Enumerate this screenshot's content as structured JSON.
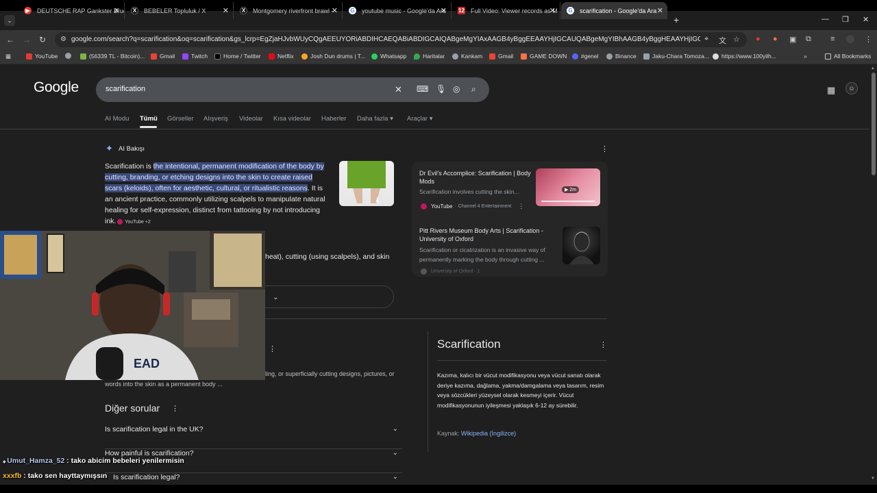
{
  "browser": {
    "tabs": [
      {
        "title": "DEUTSCHE RAP Gankster Bruder",
        "icon_color": "#e53935",
        "icon": "youtube-icon"
      },
      {
        "title": "BEBELER Topluluk / X",
        "icon_color": "#000000",
        "icon": "x-icon"
      },
      {
        "title": "Montgomery riverfront brawl -",
        "icon_color": "#000000",
        "icon": "x-icon"
      },
      {
        "title": "youtube music - Google'da Ara",
        "icon_color": "#4285f4",
        "icon": "google-icon"
      },
      {
        "title": "Full Video: Viewer records as M",
        "icon_color": "#c62828",
        "icon": "news-icon"
      },
      {
        "title": "scarification - Google'da Ara",
        "icon_color": "#4285f4",
        "icon": "google-icon"
      }
    ],
    "url": "google.com/search?q=scarification&oq=scarification&gs_lcrp=EgZjaHJvbWUyCQgAEEUYORiABDIHCAEQABiABDIGCAIQABgeMgYIAxAAGB4yBggEEAAYHjIGCAUQABgeMgYIBhAAGB4yBggHEAAYHjIGCAgQABgeMgYICRAA...",
    "bookmarks": [
      {
        "label": "YouTube",
        "color": "#e53935"
      },
      {
        "label": "",
        "color": "#9aa0a6"
      },
      {
        "label": "(56339 TL - Bitcoin)...",
        "color": "#7cb342"
      },
      {
        "label": "Gmail",
        "color": "#ea4335"
      },
      {
        "label": "Twitch",
        "color": "#9146ff"
      },
      {
        "label": "Home / Twitter",
        "color": "#000000"
      },
      {
        "label": "Netflix",
        "color": "#e50914"
      },
      {
        "label": "Josh Dun drums | T...",
        "color": "#f9a825"
      },
      {
        "label": "Whatsapp",
        "color": "#25d366"
      },
      {
        "label": "Haritalar",
        "color": "#34a853"
      },
      {
        "label": "Kankam",
        "color": "#9aa0a6"
      },
      {
        "label": "Gmail",
        "color": "#ea4335"
      },
      {
        "label": "GAME DOWN",
        "color": "#ff7043"
      },
      {
        "label": "#genel",
        "color": "#5865f2"
      },
      {
        "label": "Binance",
        "color": "#9aa0a6"
      },
      {
        "label": "Jaku-Chara Tomoza...",
        "color": "#9aa0a6"
      },
      {
        "label": "https://www.100yilh...",
        "color": "#dddddd"
      }
    ],
    "all_bookmarks": "All Bookmarks"
  },
  "google": {
    "logo": "Google",
    "query": "scarification",
    "nav": [
      "AI Modu",
      "Tümü",
      "Görseller",
      "Alışveriş",
      "Videolar",
      "Kısa videolar",
      "Haberler",
      "Daha fazla",
      "Araçlar"
    ]
  },
  "ai_overview": {
    "title": "AI Bakışı",
    "lead": "Scarification is ",
    "highlight": "the intentional, permanent modification of the body by cutting, branding, or etching designs into the skin to create raised scars (keloids), often for aesthetic, cultural, or ritualistic reasons",
    "rest": ". It is an ancient practice, commonly utilizing scalpels to manipulate natural healing for self-expression, distinct from tattooing by not introducing ink.",
    "chip": "YouTube +2",
    "partial_line": "heat), cutting (using scalpels), and skin",
    "show_more": "r",
    "cards": [
      {
        "title": "Dr Evil's Accomplice: Scarification | Body Mods",
        "snippet": "Scarification involves cutting the skin...",
        "source": "YouTube",
        "channel": "Channel 4 Entertainment",
        "duration": "2m"
      },
      {
        "title": "Pitt Rivers Museum Body Arts | Scarification - University of Oxford",
        "snippet": "Scarification or cicatrization is an invasive way of permanently marking the body through cutting ...",
        "source": "University of Oxford · 1"
      }
    ]
  },
  "snippet": {
    "line1": "ling, or superficially cutting designs, pictures, or",
    "line2": "words into the skin as a permanent body ..."
  },
  "paa": {
    "heading": "Diğer sorular",
    "questions": [
      "Is scarification legal in the UK?",
      "How painful is scarification?",
      "Is scarification legal?"
    ]
  },
  "knowledge_panel": {
    "title": "Scarification",
    "description": "Kazıma, kalıcı bir vücut modifikasyonu veya vücut sanatı olarak deriye kazıma, dağlama, yakma/damgalama veya tasarım, resim veya sözcükleri yüzeysel olarak kesmeyi içerir. Vücut modifikasyonunun iyileşmesi yaklaşık 6-12 ay sürebilir.",
    "source_label": "Kaynak:",
    "source_link": "Wikipedia (İngilizce)"
  },
  "chat": [
    {
      "user": "Umut_Hamza_52",
      "message": " : tako abicim bebeleri yenilermisin"
    },
    {
      "user": "xxxfb",
      "message": " : tako sen hayttaymışsın"
    }
  ]
}
